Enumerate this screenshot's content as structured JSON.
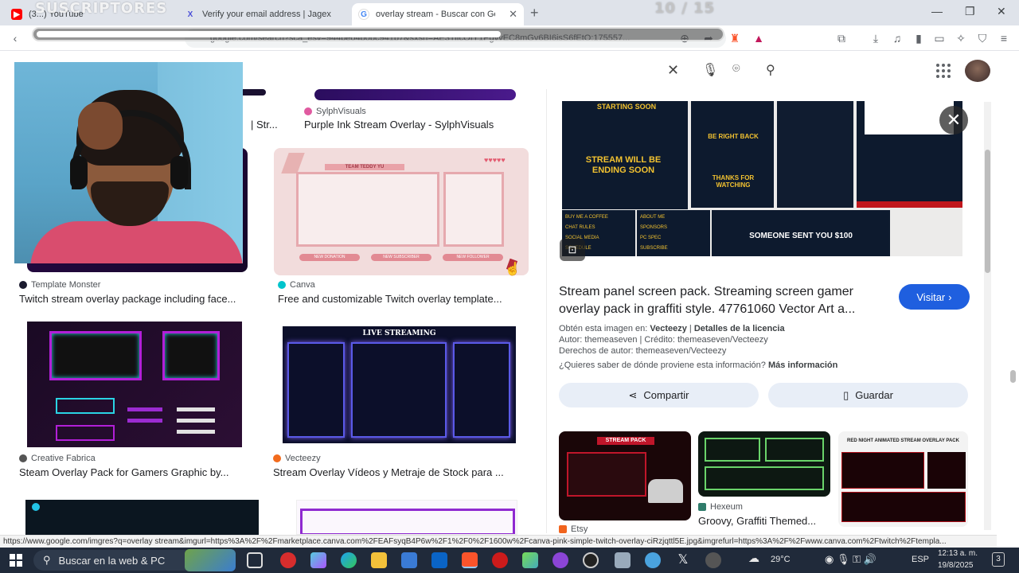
{
  "overlay": {
    "subscribers_label": "SUSCRIPTORES",
    "counter": "10 / 15",
    "progress_fraction": 0.68
  },
  "tabs": [
    {
      "label": "(3...) YouTube",
      "icon": "youtube-icon",
      "color": "#ff0000",
      "active": false
    },
    {
      "label": "Verify your email address | Jagex",
      "icon": "jagex-icon",
      "color": "#4b4fd8",
      "active": false
    },
    {
      "label": "overlay stream - Buscar con Goo",
      "icon": "google-icon",
      "color": "#4285f4",
      "active": true
    }
  ],
  "address_bar": {
    "url": "google.com/search?sca_esv=944be04b0bc941b7&sxsrf=AE3TifcOIY1PgvvEC8mGv6BI6isS6fEtO:175557..."
  },
  "brave_badge": "2",
  "results": [
    {
      "source": "SylphVisuals",
      "title": "Purple Ink Stream Overlay - SylphVisuals",
      "source_color": "#e05aa0"
    },
    {
      "source": "Template Monster",
      "title": "Twitch stream overlay package including face...",
      "source_color": "#1a1a2e"
    },
    {
      "source": "Canva",
      "title": "Free and customizable Twitch overlay template...",
      "source_color": "#00c4cc"
    },
    {
      "source": "Creative Fabrica",
      "title": "Steam Overlay Pack for Gamers Graphic by...",
      "source_color": "#555555"
    },
    {
      "source": "Vecteezy",
      "title": "Stream Overlay Vídeos y Metraje de Stock para ...",
      "source_color": "#f26b1d"
    }
  ],
  "partial_title": "| Str...",
  "canva_thumb": {
    "team_label": "TEAM TEDDY YU",
    "btn1": "NEW DONATION",
    "btn2": "NEW SUBSCRIBER",
    "btn3": "NEW FOLLOWER"
  },
  "live_thumb": {
    "label": "LIVE STREAMING"
  },
  "panel": {
    "image_texts": {
      "starting": "STARTING SOON",
      "brb": "BE RIGHT BACK",
      "ending": "STREAM WILL BE ENDING SOON",
      "thanks": "THANKS FOR WATCHING",
      "sent": "SOMEONE SENT YOU $100",
      "buy": "BUY ME A COFFEE",
      "rules": "CHAT RULES",
      "social": "SOCIAL MEDIA",
      "schedule": "SCHEDULE",
      "about": "ABOUT ME",
      "sponsors": "SPONSORS",
      "pcspec": "PC SPEC",
      "subscribe": "SUBSCRIBE"
    },
    "title_line1": "Stream panel screen pack. Streaming screen gamer",
    "title_line2": "overlay pack in graffiti style. 47761060 Vector Art a...",
    "visit_label": "Visitar",
    "obtained_prefix": "Obtén esta imagen en:",
    "obtained_source": "Vecteezy",
    "license_label": "Detalles de la licencia",
    "author_line": "Autor: themeaseven | Crédito: themeaseven/Vecteezy",
    "rights_line": "Derechos de autor: themeaseven/Vecteezy",
    "origin_question": "¿Quieres saber de dónde proviene esta información?",
    "more_info": "Más información",
    "share_label": "Compartir",
    "save_label": "Guardar",
    "related": [
      {
        "source": "Etsy",
        "title": "",
        "img_label": "STREAM PACK"
      },
      {
        "source": "Hexeum",
        "title": "Groovy, Graffiti Themed...",
        "img_label": ""
      },
      {
        "source": "",
        "title": "",
        "img_label": "RED NIGHT ANIMATED STREAM OVERLAY PACK"
      }
    ]
  },
  "status_url": "https://www.google.com/imgres?q=overlay stream&imgurl=https%3A%2F%2Fmarketplace.canva.com%2FEAFsyqB4P6w%2F1%2F0%2F1600w%2Fcanva-pink-simple-twitch-overlay-ciRzjqttl5E.jpg&imgrefurl=https%3A%2F%2Fwww.canva.com%2Ftwitch%2Ftempla...",
  "taskbar": {
    "search_placeholder": "Buscar en la web & PC",
    "weather": "29°C",
    "language": "ESP",
    "time": "12:13 a. m.",
    "date": "19/8/2025",
    "notification_count": "3"
  },
  "colors": {
    "accent_blue": "#1f5fdf",
    "taskbar": "#202a3a",
    "chip_bg": "#e8eef7"
  }
}
